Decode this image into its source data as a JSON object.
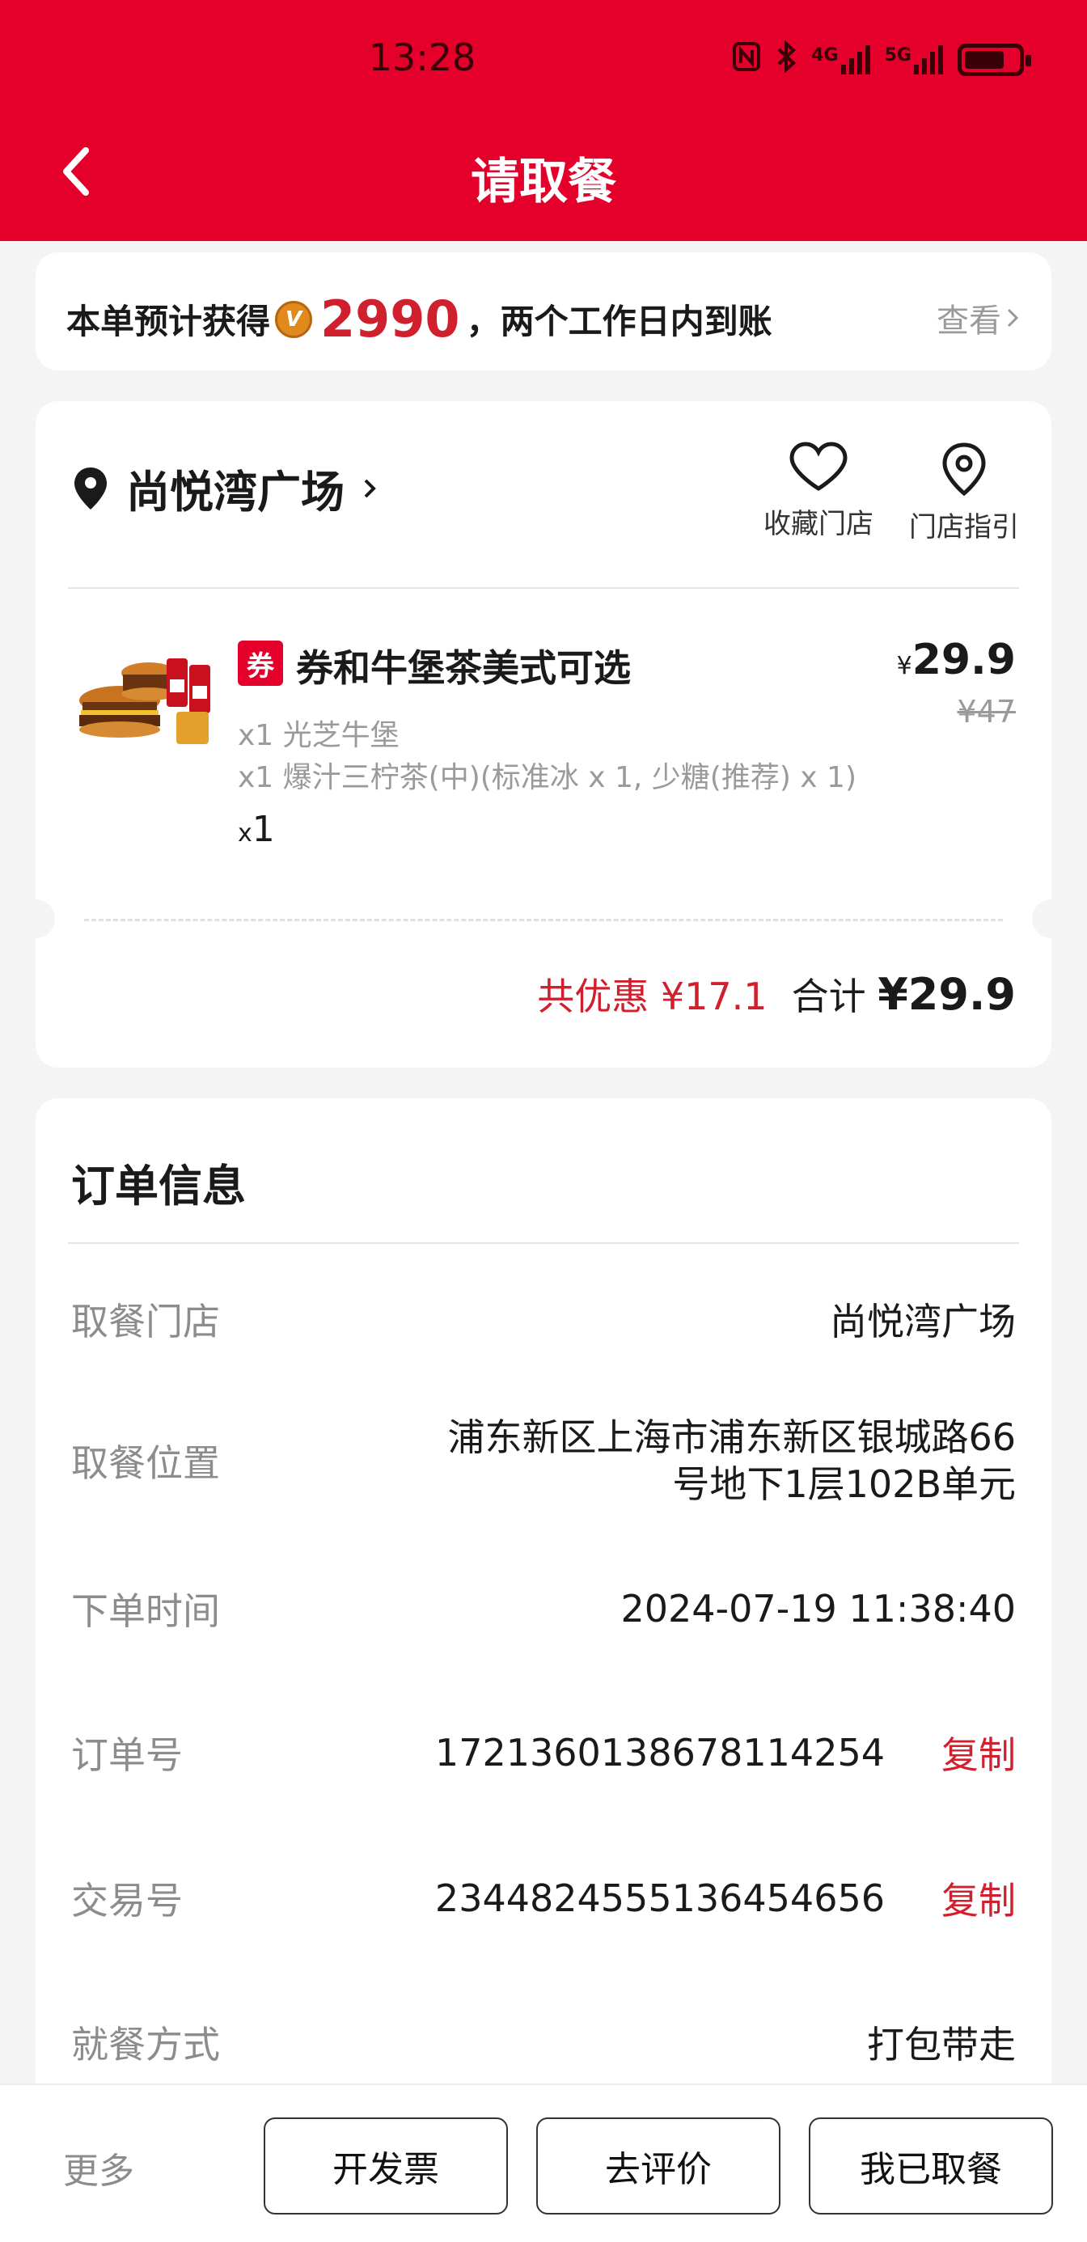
{
  "status_bar": {
    "time": "13:28",
    "network_1": "4G",
    "network_2": "5G"
  },
  "header": {
    "title": "请取餐"
  },
  "points": {
    "prefix": "本单预计获得",
    "badge": "V",
    "amount": "2990",
    "suffix": "，两个工作日内到账",
    "view_label": "查看"
  },
  "store": {
    "name": "尚悦湾广场",
    "favorite_label": "收藏门店",
    "guide_label": "门店指引"
  },
  "product": {
    "coupon_tag": "券",
    "name": "券和牛堡茶美式可选",
    "details": [
      "x1 光芝牛堡",
      "x1 爆汁三柠茶(中)(标准冰 x 1, 少糖(推荐) x 1)"
    ],
    "qty_prefix": "x",
    "qty": "1",
    "currency": "¥",
    "price": "29.9",
    "original_price": "¥47"
  },
  "totals": {
    "discount": "共优惠 ¥17.1",
    "total_label": "合计",
    "total_amount": "¥29.9"
  },
  "order_info": {
    "title": "订单信息",
    "rows": [
      {
        "label": "取餐门店",
        "value": "尚悦湾广场"
      },
      {
        "label": "取餐位置",
        "value_line1": "浦东新区上海市浦东新区银城路66",
        "value_line2": "号地下1层102B单元"
      },
      {
        "label": "下单时间",
        "value": "2024-07-19 11:38:40"
      },
      {
        "label": "订单号",
        "value": "1721360138678114254",
        "action": "复制"
      },
      {
        "label": "交易号",
        "value": "2344824555136454656",
        "action": "复制"
      },
      {
        "label": "就餐方式",
        "value": "打包带走"
      }
    ]
  },
  "bottom_bar": {
    "more": "更多",
    "invoice": "开发票",
    "review": "去评价",
    "picked_up": "我已取餐"
  },
  "colors": {
    "brand_red": "#e4002b",
    "price_red": "#d0202e"
  }
}
